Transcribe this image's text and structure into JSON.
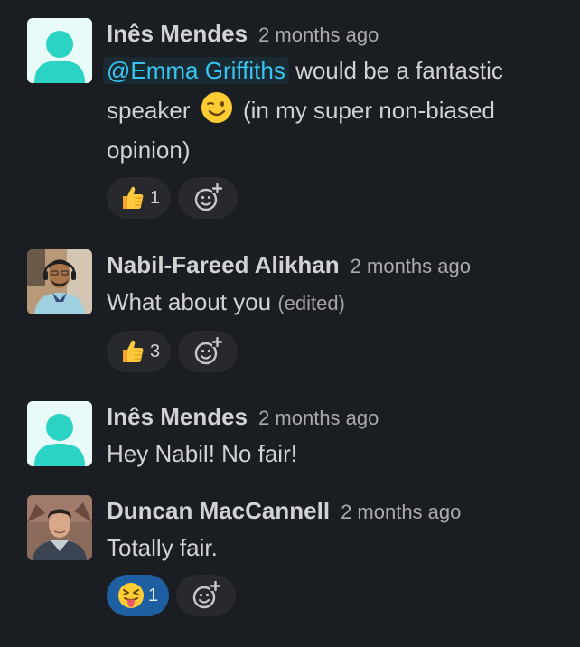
{
  "messages": [
    {
      "author": "Inês Mendes",
      "time": "2 months ago",
      "mention": "@Emma Griffiths",
      "line1_rest": " would be a fantastic",
      "line2_before": "speaker",
      "line2_after": "(in my super non-biased",
      "line3": "opinion)",
      "reactions": [
        {
          "emoji": "thumbs-up",
          "count": "1"
        }
      ]
    },
    {
      "author": "Nabil-Fareed Alikhan",
      "time": "2 months ago",
      "text": "What about you",
      "edited": "(edited)",
      "reactions": [
        {
          "emoji": "thumbs-up",
          "count": "3"
        }
      ]
    },
    {
      "author": "Inês Mendes",
      "time": "2 months ago",
      "text": "Hey Nabil! No fair!"
    },
    {
      "author": "Duncan MacCannell",
      "time": "2 months ago",
      "text": "Totally fair.",
      "reactions": [
        {
          "emoji": "tongue-wink",
          "count": "1",
          "active": true
        }
      ]
    }
  ],
  "colors": {
    "background": "#1a1d21",
    "mention": "#36c5f0",
    "reaction_active": "#1d5fa0",
    "avatar_default": "#2bd3c4"
  }
}
